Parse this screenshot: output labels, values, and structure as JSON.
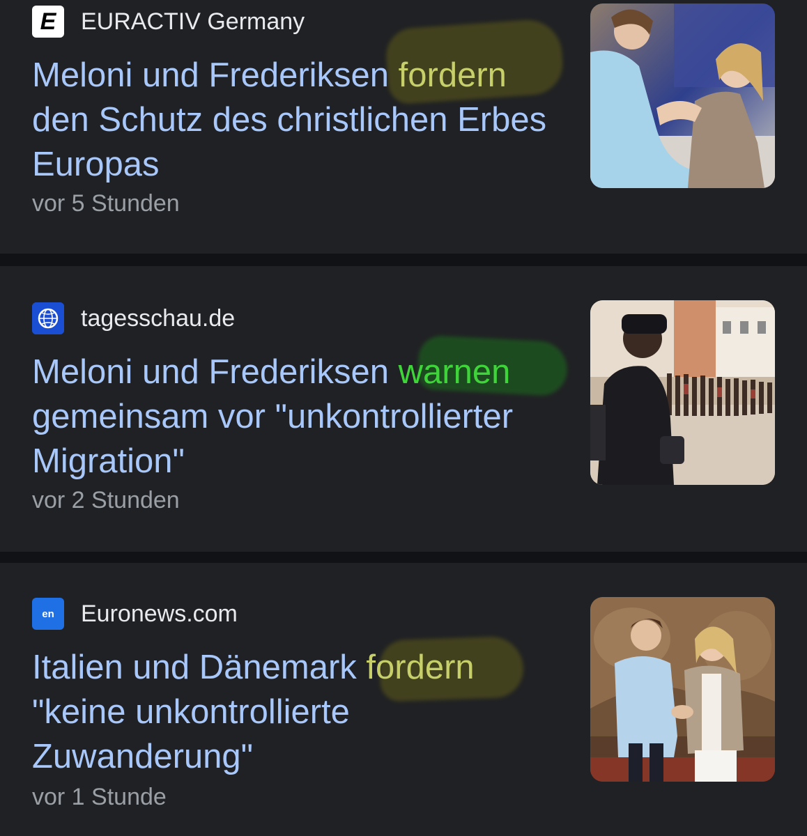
{
  "articles": [
    {
      "source": "EURACTIV Germany",
      "source_icon": "euractiv-logo-icon",
      "source_icon_letter": "E",
      "headline_before": "Meloni und Frederiksen ",
      "headline_highlight": "fordern",
      "headline_after": " den Schutz des christlichen Erbes Europas",
      "highlight_color": "#c6cf6a",
      "time": "vor 5 Stunden",
      "image": "meloni-frederiksen-embrace-photo"
    },
    {
      "source": "tagesschau.de",
      "source_icon": "tagesschau-globe-icon",
      "headline_before": "Meloni und Frederiksen ",
      "headline_highlight": "warnen",
      "headline_after": " gemeinsam vor \"unkontrollierter Migration\"",
      "highlight_color": "#3fd43a",
      "time": "vor 2 Stunden",
      "image": "police-officer-migrants-queue-photo"
    },
    {
      "source": "Euronews.com",
      "source_icon": "euronews-logo-icon",
      "source_icon_letter": "en",
      "headline_before": "Italien und Dänemark ",
      "headline_highlight": "fordern",
      "headline_after": " \"keine unkontrollierte Zuwanderung\"",
      "highlight_color": "#c6cf6a",
      "time": "vor 1 Stunde",
      "image": "meloni-frederiksen-handshake-photo"
    }
  ],
  "colors": {
    "background": "#111215",
    "card": "#202124",
    "headline": "#a8c7fa",
    "source_text": "#e8eaed",
    "time_text": "#9aa0a6"
  }
}
